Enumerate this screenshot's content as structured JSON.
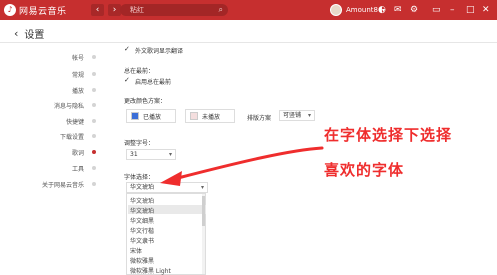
{
  "titlebar": {
    "logo_text": "网易云音乐",
    "back_arrow": "‹",
    "forward_arrow": "›",
    "search_value": "粘红",
    "username": "Amount8",
    "caret": "▾",
    "icons": [
      "skin-icon",
      "mail-icon",
      "settings-icon",
      "mini-icon",
      "minimize-icon",
      "maximize-icon",
      "close-icon"
    ]
  },
  "page": {
    "back_label": "设置",
    "back_icon": "‹"
  },
  "sidebar": {
    "items": [
      "帐号",
      "常规",
      "播放",
      "消息与隐私",
      "快捷键",
      "下载设置",
      "歌词",
      "工具",
      "关于网易云音乐"
    ],
    "active_index": 6
  },
  "content": {
    "check_mark": "✓",
    "translate_label": "外文歌词显示翻译",
    "desktop_lyrics_title": "总在最前：",
    "desktop_lyrics_option": "启用总在最前",
    "color_scheme_title": "更改颜色方案：",
    "played_label": "已播放",
    "unplayed_label": "未播放",
    "layout_label": "排版方案",
    "layout_value": "可竖铺",
    "font_size_title": "调整字号：",
    "font_size_value": "31",
    "font_select_title": "字体选择：",
    "font_select_value": "华文琥珀",
    "colors": {
      "played": "#3b6fd8",
      "unplayed": "#f4dede"
    }
  },
  "font_dropdown": {
    "items": [
      "华文琥珀",
      "华文琥珀",
      "华文细黑",
      "华文行楷",
      "华文隶书",
      "宋体",
      "微软雅黑",
      "微软雅黑 Light"
    ],
    "highlighted_index": 1
  },
  "annotation": {
    "line1": "在字体选择下选择",
    "line2": "喜欢的字体",
    "color": "#ef2d2d"
  }
}
